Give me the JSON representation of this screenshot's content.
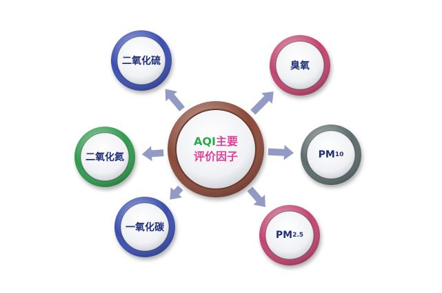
{
  "hub": {
    "aqi": "AQI",
    "line1_rest": "主要",
    "line2": "评价因子"
  },
  "factors": [
    {
      "id": "so2",
      "label": "二氧化硫",
      "sub": "",
      "color": "#3a4fb0"
    },
    {
      "id": "o3",
      "label": "臭氧",
      "sub": "",
      "color": "#c0456f"
    },
    {
      "id": "no2",
      "label": "二氧化氮",
      "sub": "",
      "color": "#2f9a4d"
    },
    {
      "id": "pm10",
      "label": "PM",
      "sub": "10",
      "color": "#5d6b6b"
    },
    {
      "id": "co",
      "label": "一氧化碳",
      "sub": "",
      "color": "#3a4fb0"
    },
    {
      "id": "pm25",
      "label": "PM",
      "sub": "2.5",
      "color": "#c0456f"
    }
  ],
  "hub_color": "#8a4a3a",
  "arrow_color": "#8088b8"
}
